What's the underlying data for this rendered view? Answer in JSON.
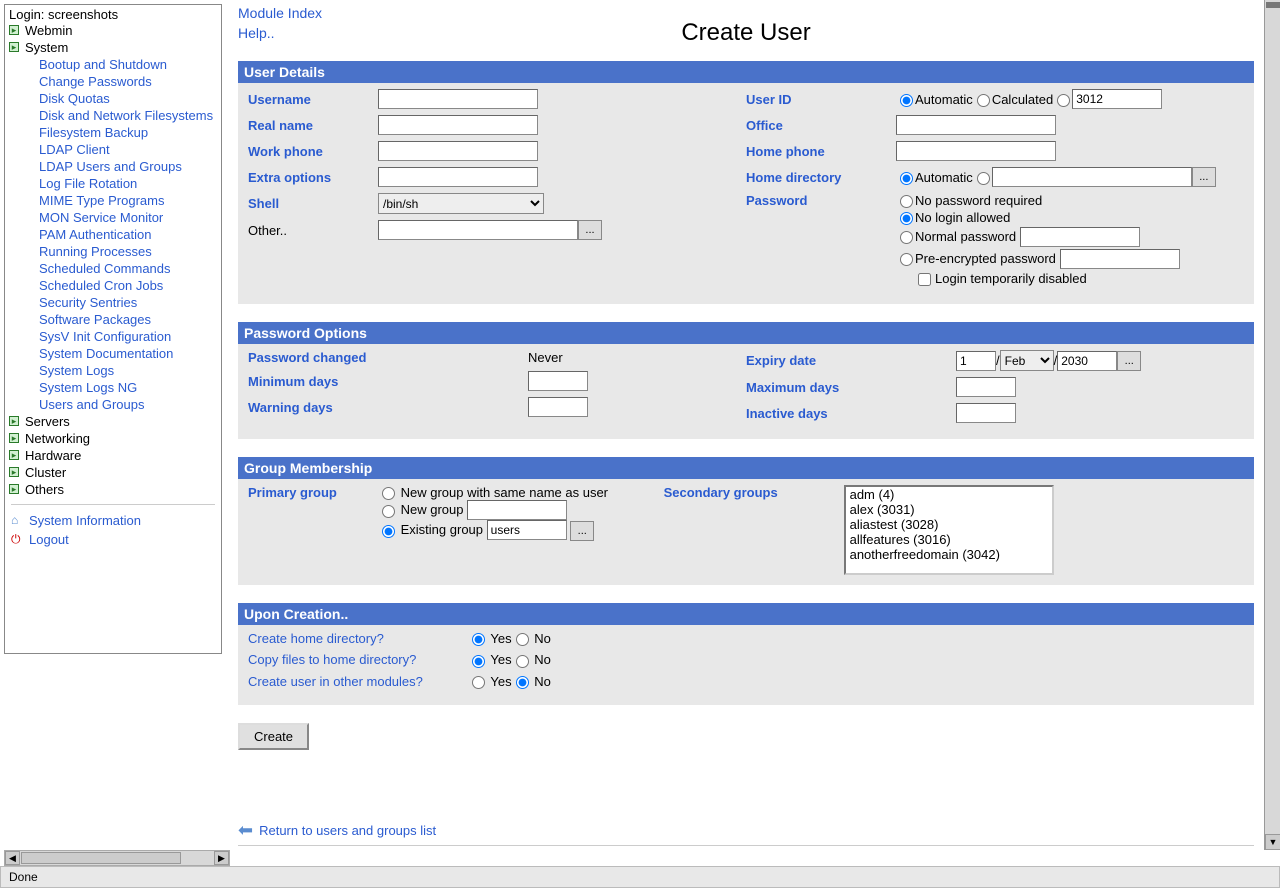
{
  "status_text": "Done",
  "sidebar": {
    "login_label": "Login: screenshots",
    "categories": [
      {
        "label": "Webmin"
      },
      {
        "label": "System"
      }
    ],
    "system_items": [
      "Bootup and Shutdown",
      "Change Passwords",
      "Disk Quotas",
      "Disk and Network Filesystems",
      "Filesystem Backup",
      "LDAP Client",
      "LDAP Users and Groups",
      "Log File Rotation",
      "MIME Type Programs",
      "MON Service Monitor",
      "PAM Authentication",
      "Running Processes",
      "Scheduled Commands",
      "Scheduled Cron Jobs",
      "Security Sentries",
      "Software Packages",
      "SysV Init Configuration",
      "System Documentation",
      "System Logs",
      "System Logs NG",
      "Users and Groups"
    ],
    "other_cats": [
      "Servers",
      "Networking",
      "Hardware",
      "Cluster",
      "Others"
    ],
    "sysinfo": "System Information",
    "logout": "Logout"
  },
  "top_links": {
    "module_index": "Module Index",
    "help": "Help.."
  },
  "page_title": "Create User",
  "sections": {
    "user_details": {
      "title": "User Details",
      "labels": {
        "username": "Username",
        "realname": "Real name",
        "workphone": "Work phone",
        "extra": "Extra options",
        "shell": "Shell",
        "other": "Other..",
        "userid": "User ID",
        "office": "Office",
        "homephone": "Home phone",
        "homedir": "Home directory",
        "password": "Password"
      },
      "userid_auto": "Automatic",
      "userid_calc": "Calculated",
      "userid_value": "3012",
      "homedir_auto": "Automatic",
      "pwd_none": "No password required",
      "pwd_nologin": "No login allowed",
      "pwd_normal": "Normal password",
      "pwd_preenc": "Pre-encrypted password",
      "pwd_tempdis": "Login temporarily disabled",
      "shell_value": "/bin/sh"
    },
    "pwd_options": {
      "title": "Password Options",
      "labels": {
        "changed": "Password changed",
        "mindays": "Minimum days",
        "warndays": "Warning days",
        "expiry": "Expiry date",
        "maxdays": "Maximum days",
        "inactive": "Inactive days"
      },
      "changed_value": "Never",
      "expiry_day": "1",
      "expiry_month": "Feb",
      "expiry_year": "2030"
    },
    "group": {
      "title": "Group Membership",
      "labels": {
        "primary": "Primary group",
        "secondary": "Secondary groups"
      },
      "new_same": "New group with same name as user",
      "new_group": "New group",
      "existing": "Existing group",
      "existing_value": "users",
      "secondary_list": [
        "adm (4)",
        "alex (3031)",
        "aliastest (3028)",
        "allfeatures (3016)",
        "anotherfreedomain (3042)"
      ]
    },
    "creation": {
      "title": "Upon Creation..",
      "labels": {
        "createhome": "Create home directory?",
        "copyfiles": "Copy files to home directory?",
        "othermod": "Create user in other modules?"
      },
      "yes": "Yes",
      "no": "No"
    }
  },
  "create_btn": "Create",
  "return_link": "Return to users and groups list",
  "dots": "..."
}
